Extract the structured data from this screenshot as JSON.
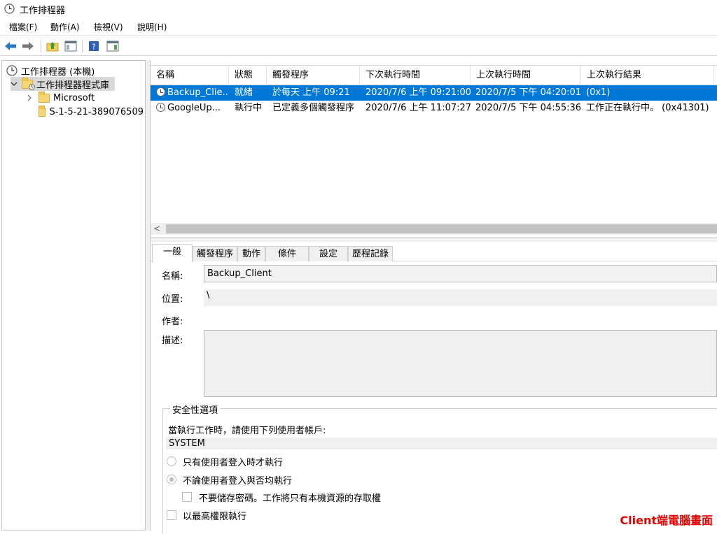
{
  "window": {
    "title": "工作排程器"
  },
  "menu": [
    "檔案(F)",
    "動作(A)",
    "檢視(V)",
    "說明(H)"
  ],
  "tree": {
    "root": "工作排程器 (本機)",
    "library": "工作排程器程式庫",
    "children": [
      "Microsoft",
      "S-1-5-21-389076509"
    ]
  },
  "task_list": {
    "columns": [
      "名稱",
      "狀態",
      "觸發程序",
      "下次執行時間",
      "上次執行時間",
      "上次執行結果"
    ],
    "rows": [
      [
        "Backup_Clie...",
        "就緒",
        "於每天 上午 09:21",
        "2020/7/6 上午 09:21:00",
        "2020/7/5 下午 04:20:01",
        "(0x1)"
      ],
      [
        "GoogleUp...",
        "執行中",
        "已定義多個觸發程序",
        "2020/7/6 上午 11:07:27",
        "2020/7/5 下午 04:55:36",
        "工作正在執行中。 (0x41301)"
      ]
    ],
    "scroll_left": "<"
  },
  "tabs": [
    "一般",
    "觸發程序",
    "動作",
    "條件",
    "設定",
    "歷程記錄"
  ],
  "general": {
    "name_label": "名稱:",
    "name_value": "Backup_Client",
    "location_label": "位置:",
    "location_value": "\\",
    "author_label": "作者:",
    "description_label": "描述:"
  },
  "security": {
    "title": "安全性選項",
    "account_prompt": "當執行工作時，請使用下列使用者帳戶:",
    "account_value": "SYSTEM",
    "option_logged_on": "只有使用者登入時才執行",
    "option_any": "不論使用者登入與否均執行",
    "option_no_password": "不要儲存密碼。工作將只有本機資源的存取權",
    "option_highest": "以最高權限執行"
  },
  "watermark": "Client端電腦畫面",
  "colors": {
    "selection": "#0078d7",
    "watermark": "#e00000"
  }
}
